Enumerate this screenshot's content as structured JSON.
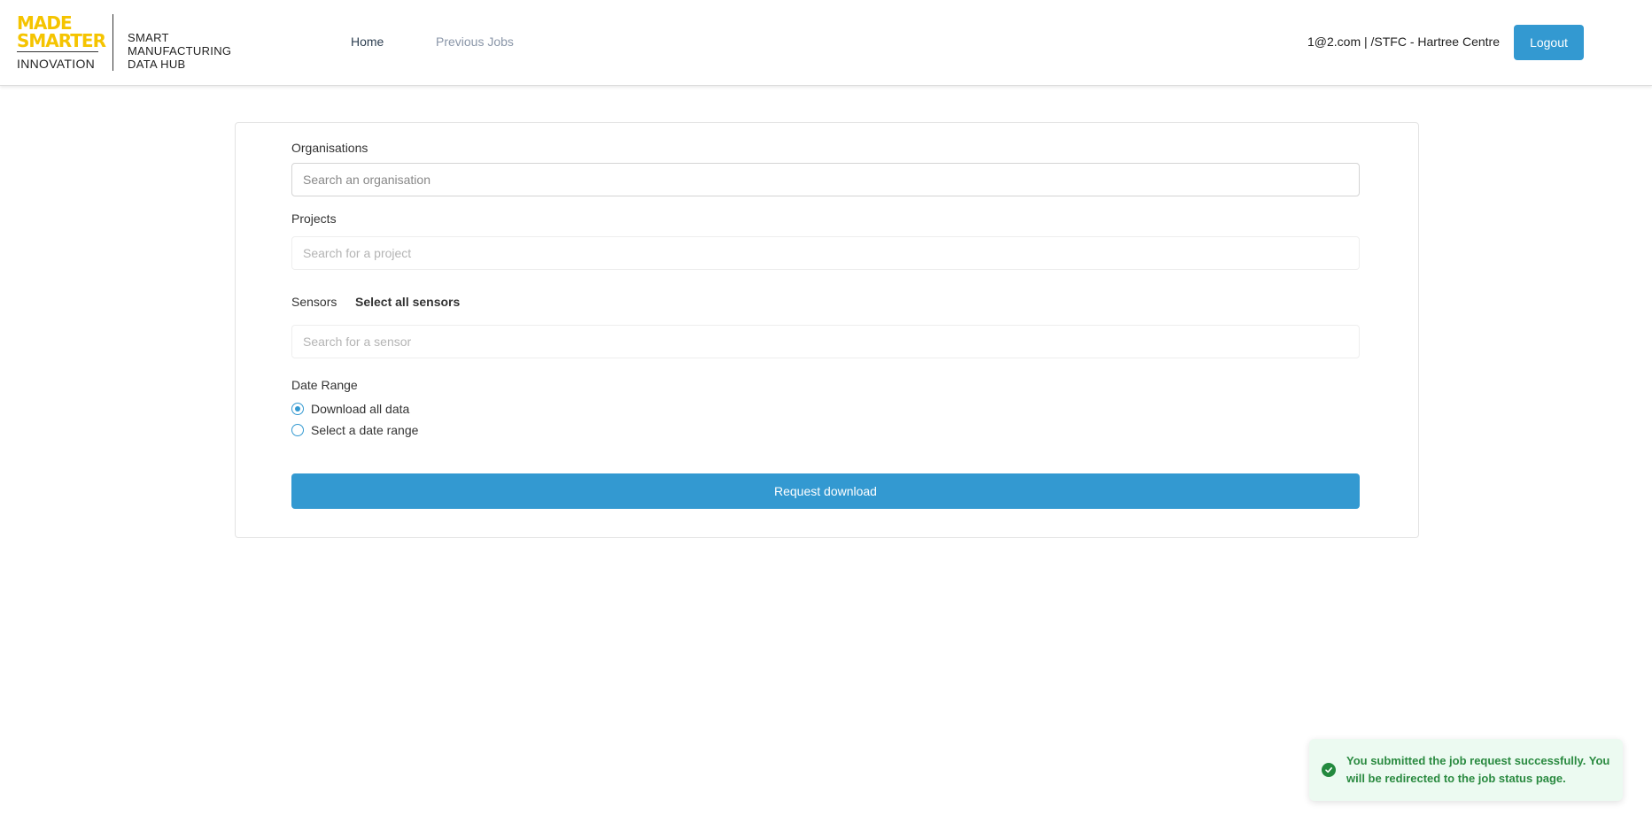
{
  "header": {
    "logo": {
      "made": "MADE",
      "smarter": "SMARTER",
      "innovation": "INNOVATION",
      "smart": "SMART",
      "manufacturing": "MANUFACTURING",
      "data_hub": "DATA HUB",
      "brand_color": "#f5c400"
    },
    "nav": {
      "home": "Home",
      "previous_jobs": "Previous Jobs"
    },
    "user": "1@2.com | /STFC - Hartree Centre",
    "logout": "Logout"
  },
  "form": {
    "organisations": {
      "label": "Organisations",
      "value": "",
      "placeholder": "Search an organisation"
    },
    "projects": {
      "label": "Projects",
      "value": "",
      "placeholder": "Search for a project"
    },
    "sensors": {
      "label": "Sensors",
      "select_all": "Select all sensors",
      "value": "",
      "placeholder": "Search for a sensor"
    },
    "date_range": {
      "label": "Date Range",
      "options": [
        {
          "label": "Download all data",
          "checked": true
        },
        {
          "label": "Select a date range",
          "checked": false
        }
      ]
    },
    "submit": "Request download"
  },
  "toast": {
    "line1": "You submitted the job request successfully. You",
    "line2": "will be redirected to the job status page.",
    "icon": "check-circle-icon"
  },
  "colors": {
    "accent": "#3399d1",
    "success_text": "#2a8a40",
    "success_bg": "#ecfaf1"
  }
}
